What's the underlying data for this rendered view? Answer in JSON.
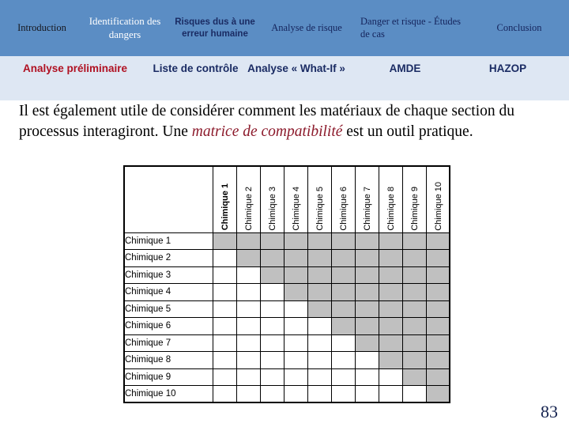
{
  "top_nav": {
    "items": [
      {
        "label": "Introduction"
      },
      {
        "label": "Identification des dangers"
      },
      {
        "label": "Risques dus à une erreur humaine"
      },
      {
        "label": "Analyse de risque"
      },
      {
        "label": "Danger et risque - Études de cas"
      },
      {
        "label": "Conclusion"
      }
    ],
    "background_color": "#5B8DC4",
    "active_color": "#FFFFFF"
  },
  "sub_nav": {
    "items": [
      {
        "label": "Analyse préliminaire"
      },
      {
        "label": "Liste de contrôle"
      },
      {
        "label": "Analyse « What-If »"
      },
      {
        "label": "AMDE"
      },
      {
        "label": "HAZOP"
      }
    ],
    "background_color": "#DEE7F3",
    "active_color": "#B01122",
    "inactive_color": "#1A2B63"
  },
  "body": {
    "paragraph_part1": "Il est également utile de considérer comment les matériaux de chaque section du processus interagiront. Une ",
    "paragraph_emphasis": "matrice de compatibilité",
    "paragraph_part2": " est un outil pratique."
  },
  "matrix": {
    "corner_label": "",
    "column_headers": [
      "Chimique 1",
      "Chimique 2",
      "Chimique 3",
      "Chimique 4",
      "Chimique 5",
      "Chimique 6",
      "Chimique 7",
      "Chimique 8",
      "Chimique 9",
      "Chimique 10"
    ],
    "row_headers": [
      "Chimique 1",
      "Chimique 2",
      "Chimique 3",
      "Chimique 4",
      "Chimique 5",
      "Chimique 6",
      "Chimique 7",
      "Chimique 8",
      "Chimique 9",
      "Chimique 10"
    ],
    "filled_color": "#C0C0C0",
    "empty_color": "#FFFFFF",
    "cells": [
      [
        1,
        1,
        1,
        1,
        1,
        1,
        1,
        1,
        1,
        1
      ],
      [
        0,
        1,
        1,
        1,
        1,
        1,
        1,
        1,
        1,
        1
      ],
      [
        0,
        0,
        1,
        1,
        1,
        1,
        1,
        1,
        1,
        1
      ],
      [
        0,
        0,
        0,
        1,
        1,
        1,
        1,
        1,
        1,
        1
      ],
      [
        0,
        0,
        0,
        0,
        1,
        1,
        1,
        1,
        1,
        1
      ],
      [
        0,
        0,
        0,
        0,
        0,
        1,
        1,
        1,
        1,
        1
      ],
      [
        0,
        0,
        0,
        0,
        0,
        0,
        1,
        1,
        1,
        1
      ],
      [
        0,
        0,
        0,
        0,
        0,
        0,
        0,
        1,
        1,
        1
      ],
      [
        0,
        0,
        0,
        0,
        0,
        0,
        0,
        0,
        1,
        1
      ],
      [
        0,
        0,
        0,
        0,
        0,
        0,
        0,
        0,
        0,
        1
      ]
    ]
  },
  "footer": {
    "page_number": "83"
  }
}
